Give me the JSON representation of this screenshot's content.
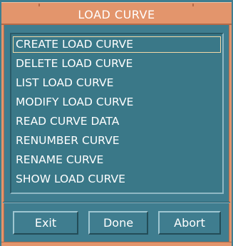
{
  "window": {
    "title": "LOAD CURVE"
  },
  "list": {
    "items": [
      {
        "label": "CREATE LOAD CURVE",
        "selected": true
      },
      {
        "label": "DELETE LOAD CURVE",
        "selected": false
      },
      {
        "label": "LIST LOAD CURVE",
        "selected": false
      },
      {
        "label": "MODIFY LOAD CURVE",
        "selected": false
      },
      {
        "label": "READ CURVE DATA",
        "selected": false
      },
      {
        "label": "RENUMBER CURVE",
        "selected": false
      },
      {
        "label": "RENAME CURVE",
        "selected": false
      },
      {
        "label": "SHOW LOAD CURVE",
        "selected": false
      }
    ]
  },
  "buttons": {
    "exit": "Exit",
    "done": "Done",
    "abort": "Abort"
  },
  "colors": {
    "title_bar": "#e3956c",
    "panel": "#3f7d8f",
    "text": "#ffffff",
    "selection_outline": "#f2d9a8"
  }
}
